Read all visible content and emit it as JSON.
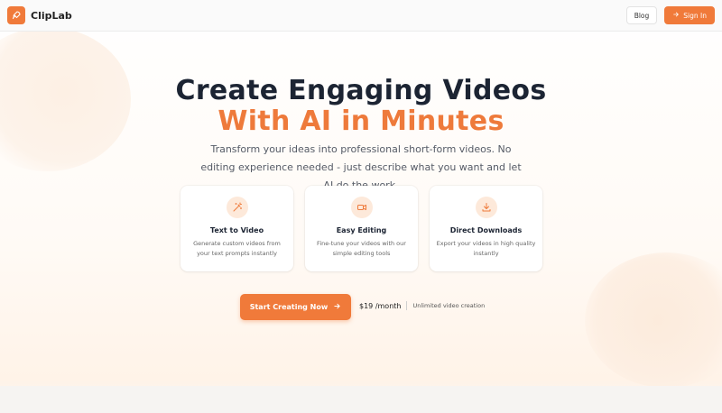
{
  "brand": {
    "name": "ClipLab",
    "logo_icon": "rocket-icon"
  },
  "nav": {
    "blog_label": "Blog",
    "signin_label": "Sign In"
  },
  "hero": {
    "title_line1": "Create Engaging Videos",
    "title_line2": "With AI in Minutes",
    "subtitle": "Transform your ideas into professional short-form videos. No editing experience needed - just describe what you want and let AI do the work."
  },
  "features": [
    {
      "icon": "magic-wand-icon",
      "title": "Text to Video",
      "description": "Generate custom videos from your text prompts instantly"
    },
    {
      "icon": "video-camera-icon",
      "title": "Easy Editing",
      "description": "Fine-tune your videos with our simple editing tools"
    },
    {
      "icon": "download-icon",
      "title": "Direct Downloads",
      "description": "Export your videos in high quality instantly"
    }
  ],
  "cta": {
    "label": "Start Creating Now",
    "price": "$19 /month",
    "price_note": "Unlimited video creation"
  },
  "colors": {
    "accent": "#f07a3a",
    "title_dark": "#1c2433",
    "icon_bg": "#fde9da"
  }
}
